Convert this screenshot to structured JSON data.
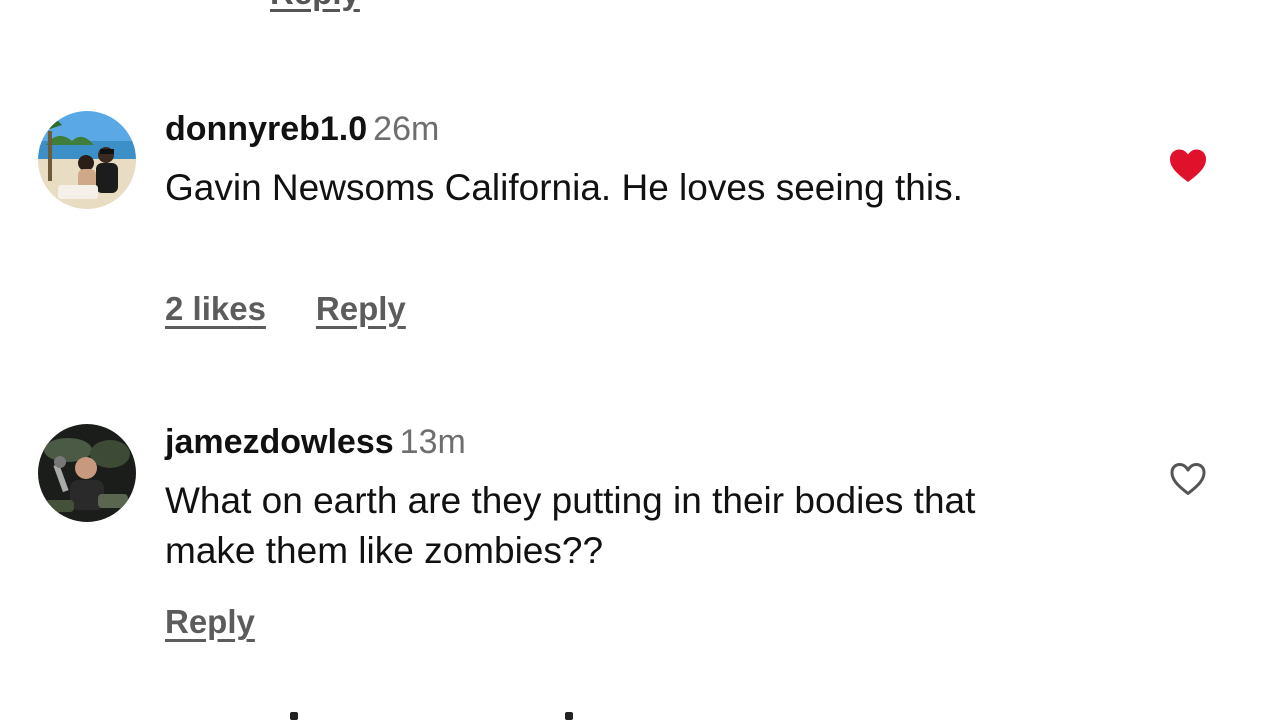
{
  "top": {
    "reply_label": "Reply"
  },
  "comments": [
    {
      "username": "donnyreb1.0",
      "time": "26m",
      "text": "Gavin Newsoms California. He loves seeing this.",
      "likes_label": "2 likes",
      "reply_label": "Reply",
      "liked": true,
      "heart_color": "#e0112b"
    },
    {
      "username": "jamezdowless",
      "time": "13m",
      "text": "What on earth are they putting in their bodies that make them like zombies??",
      "reply_label": "Reply",
      "liked": false,
      "heart_color": "#555555"
    }
  ],
  "icons": {
    "liked": "heart-filled-icon",
    "unliked": "heart-outline-icon"
  }
}
